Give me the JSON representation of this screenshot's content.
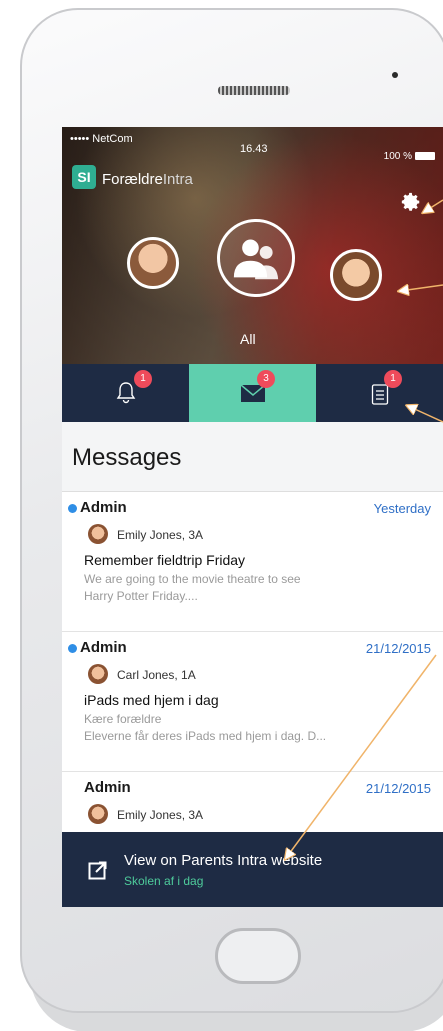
{
  "status_bar": {
    "carrier": "••••• NetCom",
    "time": "16.43",
    "battery": "100 %"
  },
  "app": {
    "logo": "SI",
    "name_part1": "Forældre",
    "name_part2": "Intra"
  },
  "children": {
    "all_label": "All"
  },
  "tabs": [
    {
      "name": "notifications",
      "icon": "bell-icon",
      "badge": "1"
    },
    {
      "name": "messages",
      "icon": "envelope-icon",
      "badge": "3"
    },
    {
      "name": "tasks",
      "icon": "clipboard-icon",
      "badge": "1"
    }
  ],
  "messages": {
    "title": "Messages",
    "items": [
      {
        "sender": "Admin",
        "date": "Yesterday",
        "student": "Emily Jones, 3A",
        "subject": "Remember fieldtrip Friday",
        "preview1": "We are going to the movie theatre to see",
        "preview2": "Harry Potter Friday....",
        "unread": true
      },
      {
        "sender": "Admin",
        "date": "21/12/2015",
        "student": "Carl Jones, 1A",
        "subject": "iPads med hjem i dag",
        "preview1": "Kære forældre",
        "preview2": "Eleverne får deres iPads med hjem i dag. D...",
        "unread": true
      },
      {
        "sender": "Admin",
        "date": "21/12/2015",
        "student": "Emily Jones, 3A",
        "unread": false
      }
    ]
  },
  "footer": {
    "title": "View on Parents Intra website",
    "subtitle": "Skolen af i dag"
  },
  "colors": {
    "navy": "#1e2b44",
    "accent": "#5fcfae",
    "badge": "#ef4b5b",
    "date_blue": "#2f6fc6",
    "annotation": "#f0b46a"
  }
}
